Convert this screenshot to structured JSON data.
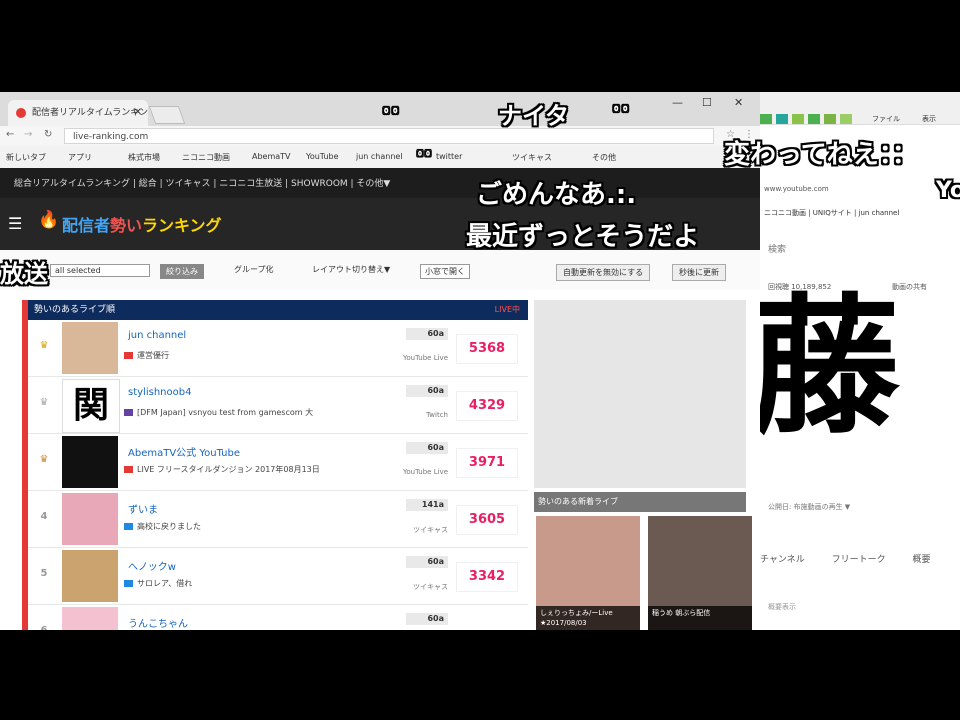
{
  "browser_left": {
    "tab_title": "配信者リアルタイムランキング",
    "address": "live-ranking.com",
    "bookmarks": [
      "新しいタブ",
      "アプリ",
      "株式市場",
      "ニコニコ動画",
      "AbemaTV",
      "YouTube",
      "jun channel",
      "twitter",
      "ツイキャス",
      "その他"
    ],
    "nav_links": "総合リアルタイムランキング | 総合 | ツイキャス | ニコニコ生放送 | SHOWROOM | その他▼",
    "site_title_a": "配信者",
    "site_title_b": "勢い",
    "site_title_c": "ランキング",
    "filter_select": "all selected",
    "filter_button": "絞り込み",
    "group_label": "グループ化",
    "layout_label": "レイアウト切り替え▼",
    "view_label": "小窓で開く",
    "auto_update_label": "自動更新を無効にする",
    "refresh_label": "秒後に更新",
    "rank_header": "勢いのあるライブ順",
    "rank_header_right": "LIVE中",
    "rows": [
      {
        "rank": "♛",
        "name": "jun channel",
        "desc": "運営優行",
        "mins": "60a",
        "site": "YouTube Live",
        "score": "5368"
      },
      {
        "rank": "♛",
        "name": "stylishnoob4",
        "desc": "[DFM Japan] vsnyou test from gamescom 大",
        "mins": "60a",
        "site": "Twitch",
        "score": "4329"
      },
      {
        "rank": "♛",
        "name": "AbemaTV公式 YouTube",
        "desc": "LIVE フリースタイルダンジョン 2017年08月13日",
        "mins": "60a",
        "site": "YouTube Live",
        "score": "3971"
      },
      {
        "rank": "4",
        "name": "ずいま",
        "desc": "高校に戻りました",
        "mins": "141a",
        "site": "ツイキャス",
        "score": "3605"
      },
      {
        "rank": "5",
        "name": "へノックw",
        "desc": "サロレア、借れ",
        "mins": "60a",
        "site": "ツイキャス",
        "score": "3342"
      },
      {
        "rank": "6",
        "name": "うんこちゃん",
        "desc": "",
        "mins": "60a",
        "site": "",
        "score": ""
      }
    ],
    "sidebar_header": "勢いのある新着ライブ",
    "mini_cards": [
      {
        "caption": "しぇりっちょみ/ーLive ★2017/08/03"
      },
      {
        "caption": "稲うめ 朝ぶら配信"
      }
    ]
  },
  "browser_right": {
    "toolbar_items": [
      "ファイル",
      "表示"
    ],
    "address": "www.youtube.com",
    "bookmarks": "ニコニコ動画 | UNIQサイト | jun channel",
    "search_placeholder": "検索",
    "stats": "回視聴 10,189,852",
    "stat_right": "動画の共有",
    "big_text": "藤",
    "meta": "公開日: 布施動画の再生 ▼",
    "tabs": [
      "チャンネル",
      "フリートーク",
      "概要"
    ],
    "footer": "概要表示"
  },
  "comments": [
    {
      "text": "ナイタ"
    },
    {
      "text": "変わってねえ：："
    },
    {
      "text": "ごめんなあ.:."
    },
    {
      "text": "最近ずっとそうだよ"
    },
    {
      "text": "放送"
    },
    {
      "text": "Yo"
    },
    {
      "text": "ﾟﾟ"
    },
    {
      "text": "ﾟﾟ"
    },
    {
      "text": "ﾟﾟ"
    }
  ]
}
